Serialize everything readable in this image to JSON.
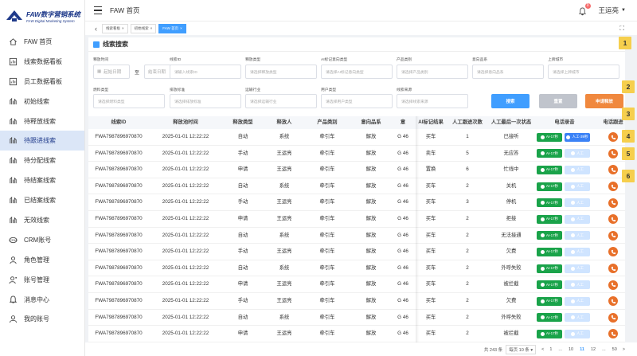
{
  "logo": {
    "cn": "FAW数字营销系统",
    "en": "FAW Digital Marketing System"
  },
  "sidebar": {
    "items": [
      {
        "label": "FAW 首页",
        "icon": "home-icon"
      },
      {
        "label": "线索数据看板",
        "icon": "chart-icon"
      },
      {
        "label": "员工数据看板",
        "icon": "chart-icon"
      },
      {
        "label": "初始线索",
        "icon": "leads-icon"
      },
      {
        "label": "待释放线索",
        "icon": "leads-icon"
      },
      {
        "label": "待跟进线索",
        "icon": "leads-icon"
      },
      {
        "label": "待分配线索",
        "icon": "leads-icon"
      },
      {
        "label": "待结案线索",
        "icon": "leads-icon"
      },
      {
        "label": "已结案线索",
        "icon": "leads-icon"
      },
      {
        "label": "无效线索",
        "icon": "leads-icon"
      },
      {
        "label": "CRM账号",
        "icon": "crm-icon"
      },
      {
        "label": "角色管理",
        "icon": "role-icon"
      },
      {
        "label": "账号管理",
        "icon": "account-icon"
      },
      {
        "label": "消息中心",
        "icon": "bell-icon"
      },
      {
        "label": "我的账号",
        "icon": "user-icon"
      }
    ],
    "active_index": 5
  },
  "header": {
    "title": "FAW 首页",
    "user": "王运亮",
    "badge": "0"
  },
  "tabs": [
    {
      "label": "线索看板"
    },
    {
      "label": "初始线索"
    },
    {
      "label": "FAW 首页",
      "active": true
    }
  ],
  "search": {
    "title": "线索搜索",
    "fields": [
      {
        "label": "释放时间",
        "start": "起始日期",
        "sep": "至",
        "end": "结束日期"
      },
      {
        "label": "线索ID",
        "placeholder": "请输入线索ID"
      },
      {
        "label": "释放类型",
        "placeholder": "请选择释放类型"
      },
      {
        "label": "AI标记意向类型",
        "placeholder": "请选择AI标记意向类型"
      },
      {
        "label": "产品类别",
        "placeholder": "请选择产品类别"
      },
      {
        "label": "意向品系",
        "placeholder": "请选择意向品系"
      },
      {
        "label": "上牌城市",
        "placeholder": "请选择上牌城市"
      },
      {
        "label": "燃料类型",
        "placeholder": "请选择燃料类型"
      },
      {
        "label": "排放标准",
        "placeholder": "请选择排放标准"
      },
      {
        "label": "运输行业",
        "placeholder": "请选择运输行业"
      },
      {
        "label": "用户类型",
        "placeholder": "请选择用户类型"
      },
      {
        "label": "线索来源",
        "placeholder": "请选择线索来源"
      }
    ],
    "buttons": {
      "search": "搜索",
      "reset": "重置",
      "apply": "申请释放"
    }
  },
  "table": {
    "headers": [
      "线索ID",
      "释放池时间",
      "释放类型",
      "释放人",
      "产品类别",
      "意向品系",
      "意",
      "AI标记结果",
      "人工跟进次数",
      "人工最后一次状态",
      "电话录音",
      "电话跟进"
    ],
    "rows": [
      {
        "id": "FWA7987896970870",
        "time": "2025-01-01 12:22:22",
        "type": "自动",
        "person": "系统",
        "product": "牵引车",
        "series": "解放",
        "intent": "G 46",
        "ai": "买车",
        "count": "1",
        "status": "已接听"
      },
      {
        "id": "FWA7987896970870",
        "time": "2025-01-01 12:22:22",
        "type": "手动",
        "person": "王运亮",
        "product": "牵引车",
        "series": "解放",
        "intent": "G 46",
        "ai": "卖车",
        "count": "5",
        "status": "无应答"
      },
      {
        "id": "FWA7987896970870",
        "time": "2025-01-01 12:22:22",
        "type": "申请",
        "person": "王运亮",
        "product": "牵引车",
        "series": "解放",
        "intent": "G 46",
        "ai": "置换",
        "count": "6",
        "status": "忙线中"
      },
      {
        "id": "FWA7987896970870",
        "time": "2025-01-01 12:22:22",
        "type": "自动",
        "person": "系统",
        "product": "牵引车",
        "series": "解放",
        "intent": "G 46",
        "ai": "买车",
        "count": "2",
        "status": "关机"
      },
      {
        "id": "FWA7987896970870",
        "time": "2025-01-01 12:22:22",
        "type": "手动",
        "person": "王运亮",
        "product": "牵引车",
        "series": "解放",
        "intent": "G 46",
        "ai": "买车",
        "count": "3",
        "status": "停机"
      },
      {
        "id": "FWA7987896970870",
        "time": "2025-01-01 12:22:22",
        "type": "申请",
        "person": "王运亮",
        "product": "牵引车",
        "series": "解放",
        "intent": "G 46",
        "ai": "买车",
        "count": "2",
        "status": "拒接"
      },
      {
        "id": "FWA7987896970870",
        "time": "2025-01-01 12:22:22",
        "type": "自动",
        "person": "系统",
        "product": "牵引车",
        "series": "解放",
        "intent": "G 46",
        "ai": "买车",
        "count": "2",
        "status": "无法接通"
      },
      {
        "id": "FWA7987896970870",
        "time": "2025-01-01 12:22:22",
        "type": "手动",
        "person": "王运亮",
        "product": "牵引车",
        "series": "解放",
        "intent": "G 46",
        "ai": "买车",
        "count": "2",
        "status": "欠费"
      },
      {
        "id": "FWA7987896970870",
        "time": "2025-01-01 12:22:22",
        "type": "自动",
        "person": "系统",
        "product": "牵引车",
        "series": "解放",
        "intent": "G 46",
        "ai": "买车",
        "count": "2",
        "status": "外呼失败"
      },
      {
        "id": "FWA7987896970870",
        "time": "2025-01-01 12:22:22",
        "type": "申请",
        "person": "王运亮",
        "product": "牵引车",
        "series": "解放",
        "intent": "G 46",
        "ai": "买车",
        "count": "2",
        "status": "被拦截"
      },
      {
        "id": "FWA7987896970870",
        "time": "2025-01-01 12:22:22",
        "type": "手动",
        "person": "王运亮",
        "product": "牵引车",
        "series": "解放",
        "intent": "G 46",
        "ai": "买车",
        "count": "2",
        "status": "欠费"
      },
      {
        "id": "FWA7987896970870",
        "time": "2025-01-01 12:22:22",
        "type": "自动",
        "person": "系统",
        "product": "牵引车",
        "series": "解放",
        "intent": "G 46",
        "ai": "买车",
        "count": "2",
        "status": "外呼失败"
      },
      {
        "id": "FWA7987896970870",
        "time": "2025-01-01 12:22:22",
        "type": "申请",
        "person": "王运亮",
        "product": "牵引车",
        "series": "解放",
        "intent": "G 46",
        "ai": "买车",
        "count": "2",
        "status": "被拦截"
      }
    ],
    "ai_record_label": "AI-17秒",
    "manual_record_label_first": "人工-39秒",
    "manual_record_label": "人工"
  },
  "pagination": {
    "total": "共 243 条",
    "page_size": "每页 10 条",
    "pages": [
      "1",
      "...",
      "10",
      "11",
      "12",
      "...",
      "50"
    ],
    "active": "11",
    "prev": "<",
    "next": ">"
  },
  "markers": [
    "1",
    "2",
    "3",
    "4",
    "5",
    "6"
  ],
  "colors": {
    "primary": "#409eff",
    "orange": "#f0883e",
    "green": "#1aa34a",
    "marker": "#f6cf4d"
  }
}
